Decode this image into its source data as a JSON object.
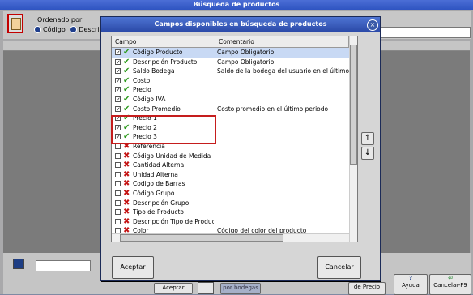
{
  "window": {
    "title": "Búsqueda de productos"
  },
  "search_panel": {
    "ordered_by_label": "Ordenado por",
    "options": [
      "Código",
      "Descripc"
    ]
  },
  "bottom_bar": {
    "accept": "Aceptar",
    "por_bodegas": "por bodegas",
    "de_precio": "de Precio",
    "help": "Ayuda",
    "close": "Cancelar-F9"
  },
  "dialog": {
    "title": "Campos disponibles en búsqueda de productos",
    "columns": [
      "Campo",
      "Comentario"
    ],
    "rows": [
      {
        "field": "Código Producto",
        "comment": "Campo Obligatorio",
        "checked": true,
        "selected": true
      },
      {
        "field": "Descripción Producto",
        "comment": "Campo Obligatorio",
        "checked": true
      },
      {
        "field": "Saldo Bodega",
        "comment": "Saldo de la bodega del usuario en el último perio",
        "checked": true
      },
      {
        "field": "Costo",
        "comment": "",
        "checked": true
      },
      {
        "field": "Precio",
        "comment": "",
        "checked": true
      },
      {
        "field": "Código IVA",
        "comment": "",
        "checked": true
      },
      {
        "field": "Costo Promedio",
        "comment": "Costo promedio en el último periodo",
        "checked": true
      },
      {
        "field": "Precio 1",
        "comment": "",
        "checked": true
      },
      {
        "field": "Precio 2",
        "comment": "",
        "checked": true
      },
      {
        "field": "Precio 3",
        "comment": "",
        "checked": true
      },
      {
        "field": "Referencia",
        "comment": "",
        "checked": false
      },
      {
        "field": "Código Unidad de Medida",
        "comment": "",
        "checked": false
      },
      {
        "field": "Cantidad Alterna",
        "comment": "",
        "checked": false
      },
      {
        "field": "Unidad Alterna",
        "comment": "",
        "checked": false
      },
      {
        "field": "Codigo de Barras",
        "comment": "",
        "checked": false
      },
      {
        "field": "Código Grupo",
        "comment": "",
        "checked": false
      },
      {
        "field": "Descripción Grupo",
        "comment": "",
        "checked": false
      },
      {
        "field": "Tipo de Producto",
        "comment": "",
        "checked": false
      },
      {
        "field": "Descripción Tipo de Producto",
        "comment": "",
        "checked": false
      },
      {
        "field": "Color",
        "comment": "Código del color del producto",
        "checked": false
      }
    ],
    "accept": "Aceptar",
    "cancel": "Cancelar"
  }
}
